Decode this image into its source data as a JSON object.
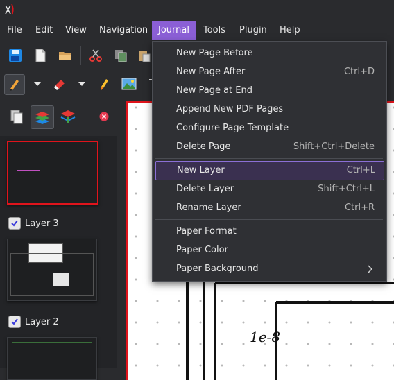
{
  "menubar": {
    "items": [
      "File",
      "Edit",
      "View",
      "Navigation",
      "Journal",
      "Tools",
      "Plugin",
      "Help"
    ],
    "active": "Journal"
  },
  "journal_menu": {
    "items": [
      {
        "label": "New Page Before",
        "shortcut": ""
      },
      {
        "label": "New Page After",
        "shortcut": "Ctrl+D"
      },
      {
        "label": "New Page at End",
        "shortcut": ""
      },
      {
        "label": "Append New PDF Pages",
        "shortcut": ""
      },
      {
        "label": "Configure Page Template",
        "shortcut": ""
      },
      {
        "label": "Delete Page",
        "shortcut": "Shift+Ctrl+Delete"
      },
      {
        "label": "New Layer",
        "shortcut": "Ctrl+L"
      },
      {
        "label": "Delete Layer",
        "shortcut": "Shift+Ctrl+L"
      },
      {
        "label": "Rename Layer",
        "shortcut": "Ctrl+R"
      },
      {
        "label": "Paper Format",
        "shortcut": ""
      },
      {
        "label": "Paper Color",
        "shortcut": ""
      },
      {
        "label": "Paper Background",
        "shortcut": ""
      }
    ],
    "highlighted": "New Layer"
  },
  "sidebar": {
    "layers": [
      {
        "label": "Layer 3",
        "checked": true
      },
      {
        "label": "Layer 2",
        "checked": true
      }
    ]
  },
  "canvas": {
    "handwriting": "1e-8",
    "partial_text": "e"
  },
  "colors": {
    "accent": "#8b5fd6",
    "selection_red": "#e0141c",
    "background": "#2a2b2e"
  }
}
